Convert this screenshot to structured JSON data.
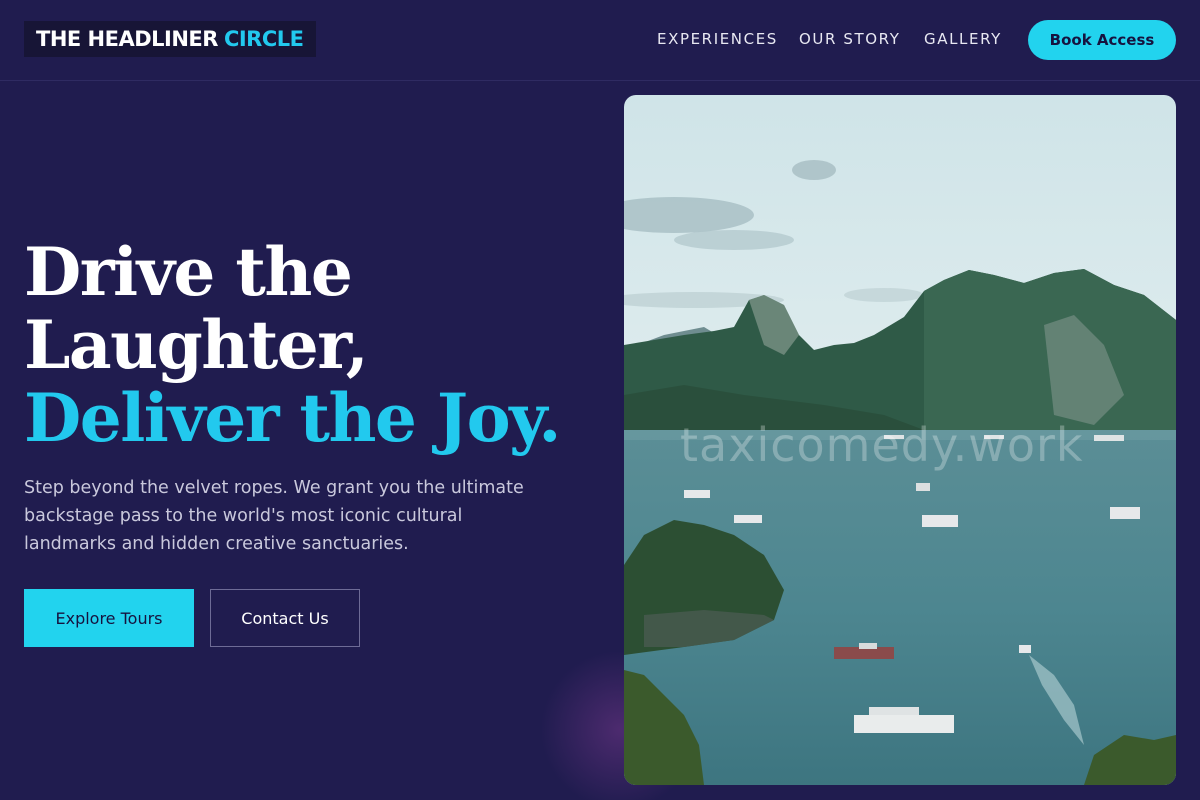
{
  "header": {
    "logo_primary": "THE HEADLINER",
    "logo_accent": "CIRCLE",
    "nav": [
      "EXPERIENCES",
      "OUR STORY",
      "GALLERY"
    ],
    "cta_label": "Book Access"
  },
  "hero": {
    "headline_line1": "Drive the",
    "headline_line2": "Laughter,",
    "headline_accent": "Deliver the Joy.",
    "description": "Step beyond the velvet ropes. We grant you the ultimate backstage pass to the world's most iconic cultural landmarks and hidden creative sanctuaries.",
    "primary_button": "Explore Tours",
    "secondary_button": "Contact Us"
  },
  "image": {
    "watermark": "taxicomedy.work"
  },
  "colors": {
    "background": "#201c4f",
    "accent": "#22d3ee",
    "logo_bg": "#171536"
  }
}
